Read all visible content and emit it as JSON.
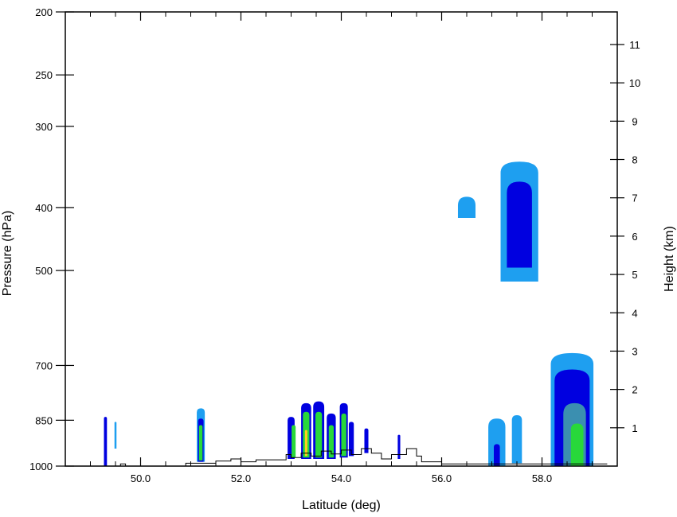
{
  "chart_data": {
    "type": "contour",
    "title": "",
    "xlabel": "Latitude (deg)",
    "ylabel_left": "Pressure (hPa)",
    "ylabel_right": "Height (km)",
    "xlim": [
      48.5,
      59.5
    ],
    "ylim_pressure": [
      1000,
      200
    ],
    "y_scale": "log-pressure",
    "ylim_height_km": [
      0,
      11.85
    ],
    "grid": false,
    "legend": "none",
    "x_ticks": [
      {
        "value": 50,
        "label": "50.0"
      },
      {
        "value": 52,
        "label": "52.0"
      },
      {
        "value": 54,
        "label": "54.0"
      },
      {
        "value": 56,
        "label": "56.0"
      },
      {
        "value": 58,
        "label": "58.0"
      }
    ],
    "x_minor_step": 0.5,
    "pressure_ticks": [
      {
        "value": 200,
        "label": "200"
      },
      {
        "value": 250,
        "label": "250"
      },
      {
        "value": 300,
        "label": "300"
      },
      {
        "value": 400,
        "label": "400"
      },
      {
        "value": 500,
        "label": "500"
      },
      {
        "value": 700,
        "label": "700"
      },
      {
        "value": 850,
        "label": "850"
      },
      {
        "value": 1000,
        "label": "1000"
      }
    ],
    "height_ticks": [
      {
        "value": 1,
        "label": "1"
      },
      {
        "value": 2,
        "label": "2"
      },
      {
        "value": 3,
        "label": "3"
      },
      {
        "value": 4,
        "label": "4"
      },
      {
        "value": 5,
        "label": "5"
      },
      {
        "value": 6,
        "label": "6"
      },
      {
        "value": 7,
        "label": "7"
      },
      {
        "value": 8,
        "label": "8"
      },
      {
        "value": 9,
        "label": "9"
      },
      {
        "value": 10,
        "label": "10"
      },
      {
        "value": 11,
        "label": "11"
      }
    ],
    "level_colors": [
      "#1e9ff0",
      "#0000e0",
      "#3b8fb0",
      "#28d83a",
      "#00ff00",
      "#ffd020"
    ],
    "contour_cells": [
      {
        "lat": 49.3,
        "p_top": 840,
        "p_bot": 1000,
        "w": 0.06,
        "level": 1
      },
      {
        "lat": 49.5,
        "p_top": 855,
        "p_bot": 940,
        "w": 0.04,
        "level": 0
      },
      {
        "lat": 51.2,
        "p_top": 815,
        "p_bot": 985,
        "w": 0.16,
        "level": 0
      },
      {
        "lat": 51.2,
        "p_top": 845,
        "p_bot": 985,
        "w": 0.11,
        "level": 1
      },
      {
        "lat": 51.2,
        "p_top": 865,
        "p_bot": 980,
        "w": 0.07,
        "level": 3
      },
      {
        "lat": 53.0,
        "p_top": 840,
        "p_bot": 975,
        "w": 0.14,
        "level": 1
      },
      {
        "lat": 53.05,
        "p_top": 865,
        "p_bot": 970,
        "w": 0.08,
        "level": 3
      },
      {
        "lat": 53.3,
        "p_top": 800,
        "p_bot": 975,
        "w": 0.2,
        "level": 1
      },
      {
        "lat": 53.3,
        "p_top": 825,
        "p_bot": 970,
        "w": 0.13,
        "level": 3
      },
      {
        "lat": 53.3,
        "p_top": 880,
        "p_bot": 965,
        "w": 0.05,
        "level": 5
      },
      {
        "lat": 53.55,
        "p_top": 795,
        "p_bot": 975,
        "w": 0.22,
        "level": 1
      },
      {
        "lat": 53.55,
        "p_top": 825,
        "p_bot": 970,
        "w": 0.13,
        "level": 3
      },
      {
        "lat": 53.8,
        "p_top": 830,
        "p_bot": 975,
        "w": 0.18,
        "level": 1
      },
      {
        "lat": 53.8,
        "p_top": 865,
        "p_bot": 970,
        "w": 0.1,
        "level": 3
      },
      {
        "lat": 54.05,
        "p_top": 800,
        "p_bot": 970,
        "w": 0.16,
        "level": 1
      },
      {
        "lat": 54.05,
        "p_top": 830,
        "p_bot": 965,
        "w": 0.1,
        "level": 3
      },
      {
        "lat": 54.2,
        "p_top": 855,
        "p_bot": 965,
        "w": 0.1,
        "level": 1
      },
      {
        "lat": 54.5,
        "p_top": 875,
        "p_bot": 955,
        "w": 0.08,
        "level": 1
      },
      {
        "lat": 55.15,
        "p_top": 895,
        "p_bot": 975,
        "w": 0.05,
        "level": 1
      },
      {
        "lat": 57.1,
        "p_top": 845,
        "p_bot": 1000,
        "w": 0.34,
        "level": 0
      },
      {
        "lat": 57.1,
        "p_top": 925,
        "p_bot": 1000,
        "w": 0.12,
        "level": 1
      },
      {
        "lat": 57.5,
        "p_top": 835,
        "p_bot": 990,
        "w": 0.2,
        "level": 0
      },
      {
        "lat": 58.6,
        "p_top": 670,
        "p_bot": 1000,
        "w": 0.85,
        "level": 0
      },
      {
        "lat": 58.6,
        "p_top": 710,
        "p_bot": 1000,
        "w": 0.7,
        "level": 1
      },
      {
        "lat": 58.65,
        "p_top": 800,
        "p_bot": 1000,
        "w": 0.45,
        "level": 2
      },
      {
        "lat": 58.7,
        "p_top": 860,
        "p_bot": 1000,
        "w": 0.25,
        "level": 3
      },
      {
        "lat": 56.5,
        "p_top": 385,
        "p_bot": 415,
        "w": 0.35,
        "level": 0
      },
      {
        "lat": 57.55,
        "p_top": 340,
        "p_bot": 520,
        "w": 0.75,
        "level": 0
      },
      {
        "lat": 57.55,
        "p_top": 365,
        "p_bot": 495,
        "w": 0.5,
        "level": 1
      }
    ],
    "orography": [
      [
        48.5,
        1000
      ],
      [
        49.6,
        1000
      ],
      [
        49.6,
        992
      ],
      [
        49.7,
        992
      ],
      [
        49.7,
        1000
      ],
      [
        50.9,
        1000
      ],
      [
        50.9,
        990
      ],
      [
        51.5,
        990
      ],
      [
        51.5,
        982
      ],
      [
        51.8,
        982
      ],
      [
        51.8,
        975
      ],
      [
        52.0,
        975
      ],
      [
        52.0,
        985
      ],
      [
        52.3,
        985
      ],
      [
        52.3,
        978
      ],
      [
        52.9,
        978
      ],
      [
        52.9,
        960
      ],
      [
        53.0,
        960
      ],
      [
        53.0,
        970
      ],
      [
        53.2,
        970
      ],
      [
        53.2,
        955
      ],
      [
        53.4,
        955
      ],
      [
        53.4,
        965
      ],
      [
        53.6,
        965
      ],
      [
        53.6,
        948
      ],
      [
        53.8,
        948
      ],
      [
        53.8,
        958
      ],
      [
        54.0,
        958
      ],
      [
        54.0,
        945
      ],
      [
        54.2,
        945
      ],
      [
        54.2,
        960
      ],
      [
        54.4,
        960
      ],
      [
        54.4,
        940
      ],
      [
        54.6,
        940
      ],
      [
        54.6,
        955
      ],
      [
        54.8,
        955
      ],
      [
        54.8,
        975
      ],
      [
        55.0,
        975
      ],
      [
        55.0,
        960
      ],
      [
        55.3,
        960
      ],
      [
        55.3,
        940
      ],
      [
        55.5,
        940
      ],
      [
        55.5,
        965
      ],
      [
        55.6,
        965
      ],
      [
        55.6,
        985
      ],
      [
        56.0,
        985
      ],
      [
        56.0,
        992
      ],
      [
        59.3,
        992
      ]
    ]
  }
}
